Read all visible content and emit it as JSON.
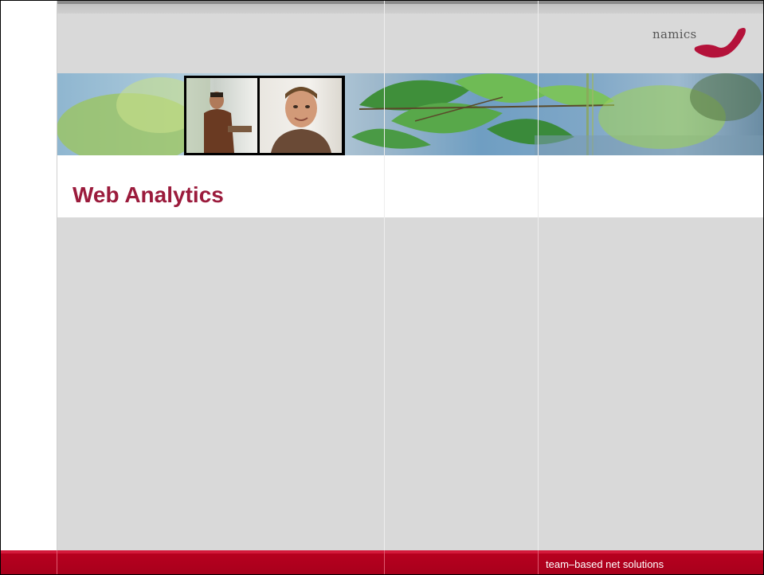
{
  "slide": {
    "title": "Web Analytics",
    "tagline": "team–based net solutions"
  },
  "logo": {
    "text": "namics",
    "brand_color": "#b4123a"
  },
  "colors": {
    "title": "#9b1b3c",
    "footer": "#b9001f",
    "background_grey": "#d9d9d9"
  }
}
